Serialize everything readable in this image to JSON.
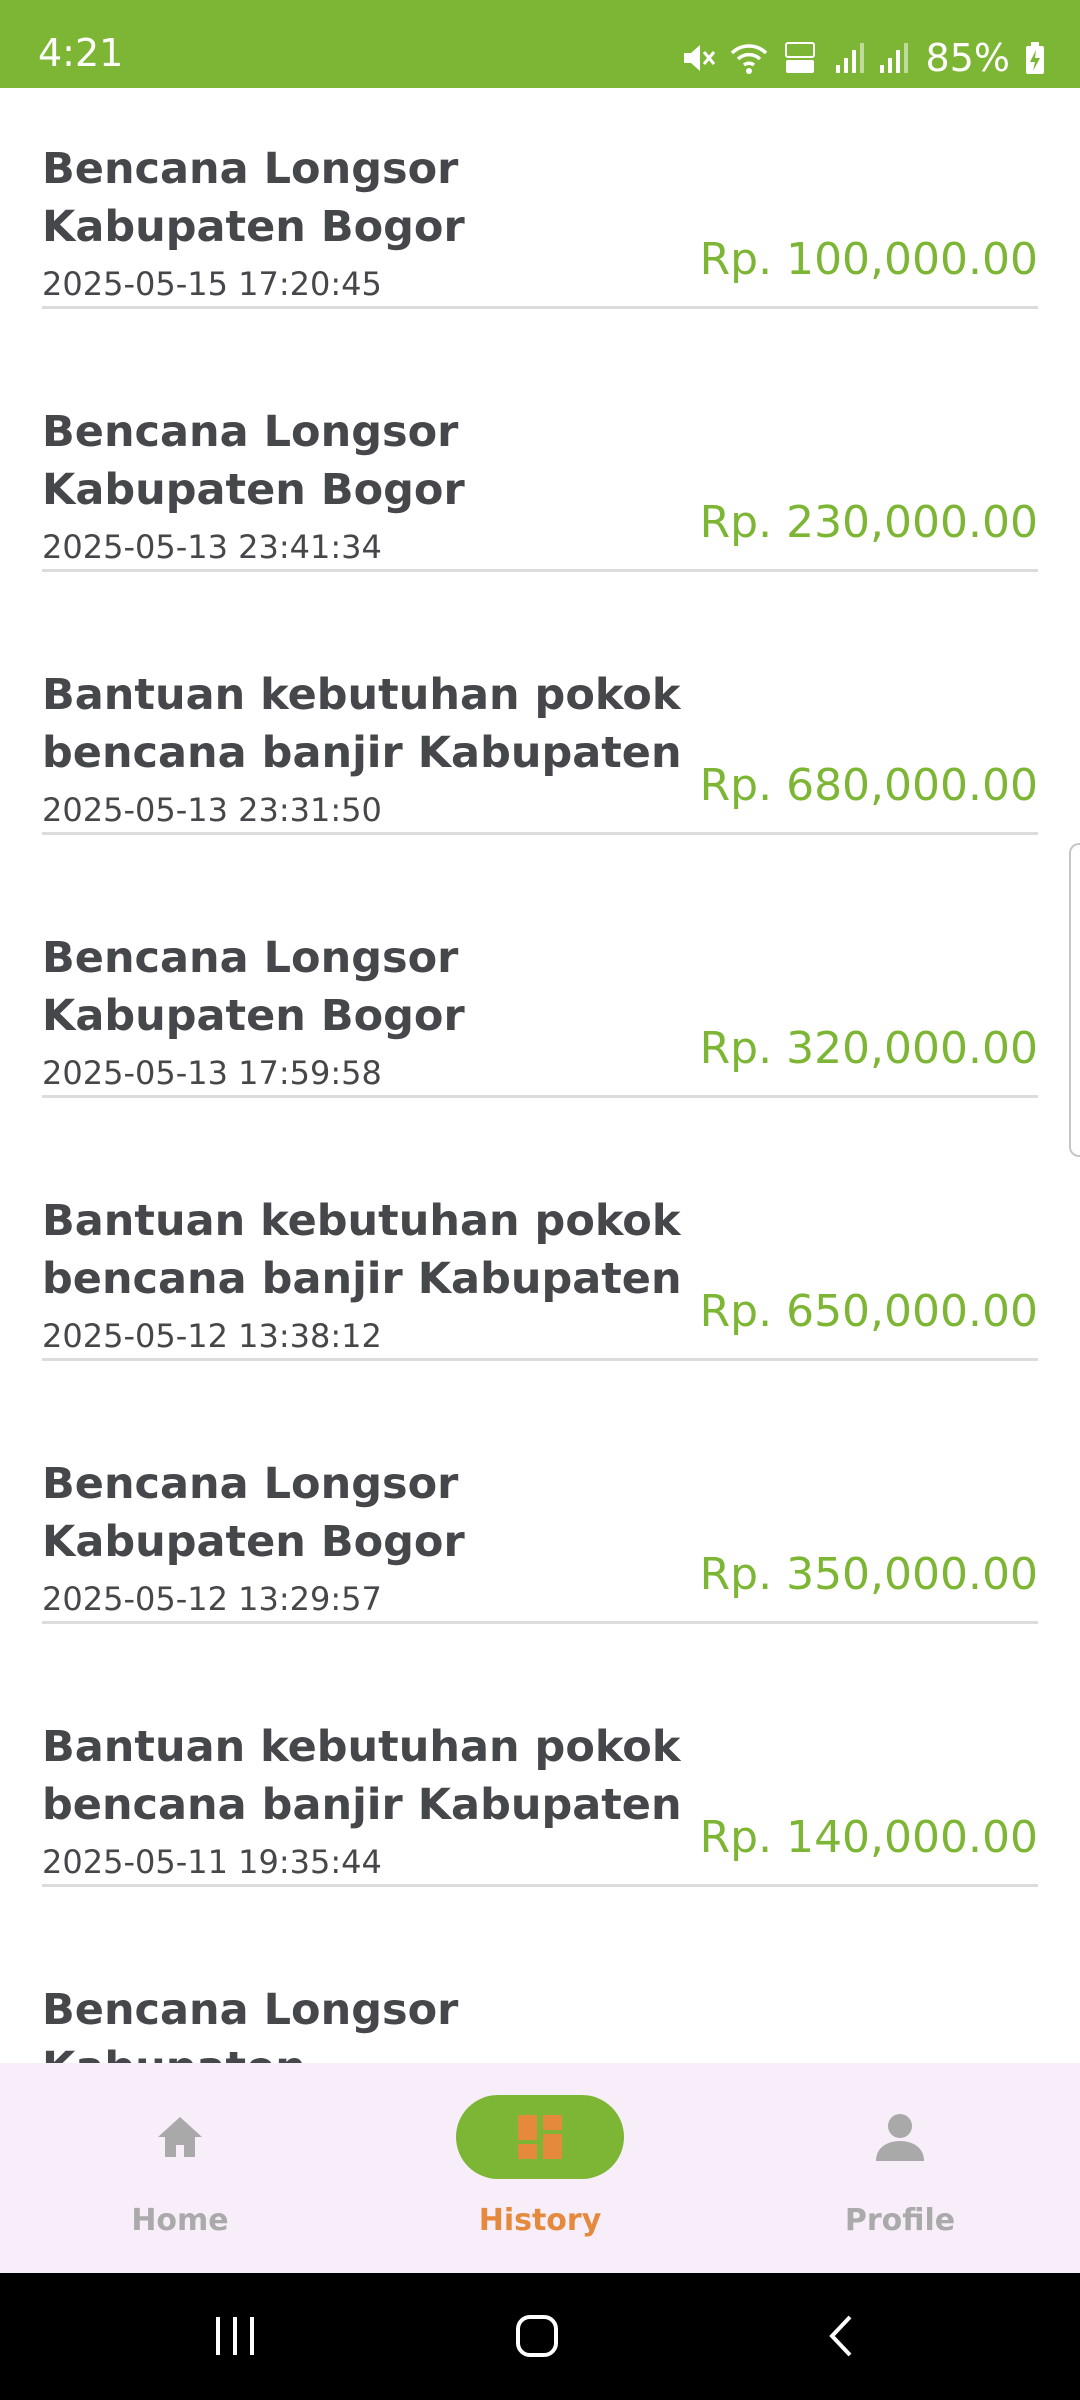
{
  "status_bar": {
    "time": "4:21",
    "battery": "85%",
    "icons": [
      "mute-icon",
      "wifi-icon",
      "volte-icon",
      "signal-icon",
      "signal-icon",
      "battery-charging-icon"
    ],
    "background": "#7db634"
  },
  "transactions": [
    {
      "title": "Bencana Longsor Kabupaten Bogor",
      "date": "2025-05-15 17:20:45",
      "amount": "Rp. 100,000.00"
    },
    {
      "title": "Bencana Longsor Kabupaten Bogor",
      "date": "2025-05-13 23:41:34",
      "amount": "Rp. 230,000.00"
    },
    {
      "title": "Bantuan kebutuhan pokok bencana banjir Kabupaten",
      "date": "2025-05-13 23:31:50",
      "amount": "Rp. 680,000.00"
    },
    {
      "title": "Bencana Longsor Kabupaten Bogor",
      "date": "2025-05-13 17:59:58",
      "amount": "Rp. 320,000.00"
    },
    {
      "title": "Bantuan kebutuhan pokok bencana banjir Kabupaten",
      "date": "2025-05-12 13:38:12",
      "amount": "Rp. 650,000.00"
    },
    {
      "title": "Bencana Longsor Kabupaten Bogor",
      "date": "2025-05-12 13:29:57",
      "amount": "Rp. 350,000.00"
    },
    {
      "title": "Bantuan kebutuhan pokok bencana banjir Kabupaten",
      "date": "2025-05-11 19:35:44",
      "amount": "Rp. 140,000.00"
    },
    {
      "title": "Bencana Longsor Kabupaten Bogor",
      "date": "",
      "amount": ""
    }
  ],
  "bottom_nav": {
    "items": [
      {
        "label": "Home",
        "icon": "home-icon",
        "active": false
      },
      {
        "label": "History",
        "icon": "dashboard-icon",
        "active": true
      },
      {
        "label": "Profile",
        "icon": "person-icon",
        "active": false
      }
    ]
  },
  "colors": {
    "accent": "#7db634",
    "active_label": "#e58a3c",
    "inactive": "#aaaaaa",
    "nav_background": "#f7eef9"
  }
}
